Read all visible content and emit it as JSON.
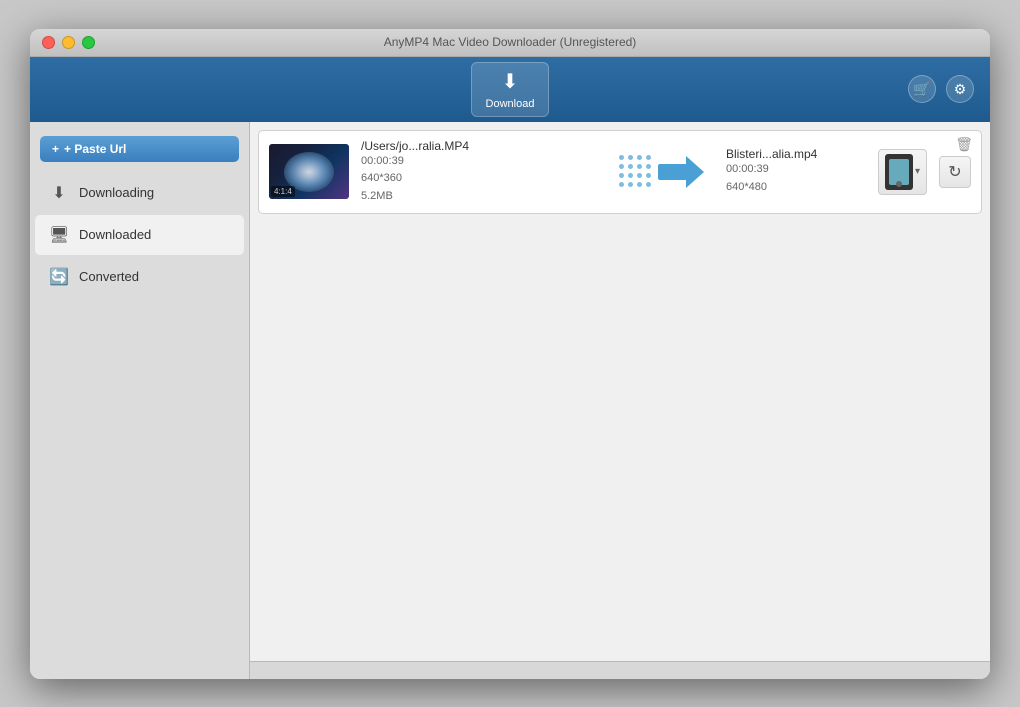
{
  "window": {
    "title": "AnyMP4 Mac Video Downloader (Unregistered)"
  },
  "toolbar": {
    "download_label": "Download",
    "download_icon": "⬇",
    "cart_icon": "🛒",
    "settings_icon": "⚙"
  },
  "sidebar": {
    "paste_url_label": "+ Paste Url",
    "items": [
      {
        "id": "downloading",
        "label": "Downloading",
        "icon": "⬇"
      },
      {
        "id": "downloaded",
        "label": "Downloaded",
        "icon": "🖥"
      },
      {
        "id": "converted",
        "label": "Converted",
        "icon": "🔄"
      }
    ]
  },
  "file_list": {
    "items": [
      {
        "source": {
          "filename": "/Users/jo...ralia.MP4",
          "duration": "00:00:39",
          "resolution": "640*360",
          "size": "5.2MB"
        },
        "output": {
          "filename": "Blisteri...alia.mp4",
          "duration": "00:00:39",
          "resolution": "640*480"
        }
      }
    ]
  },
  "active_tab": "downloaded",
  "status_bar": {}
}
